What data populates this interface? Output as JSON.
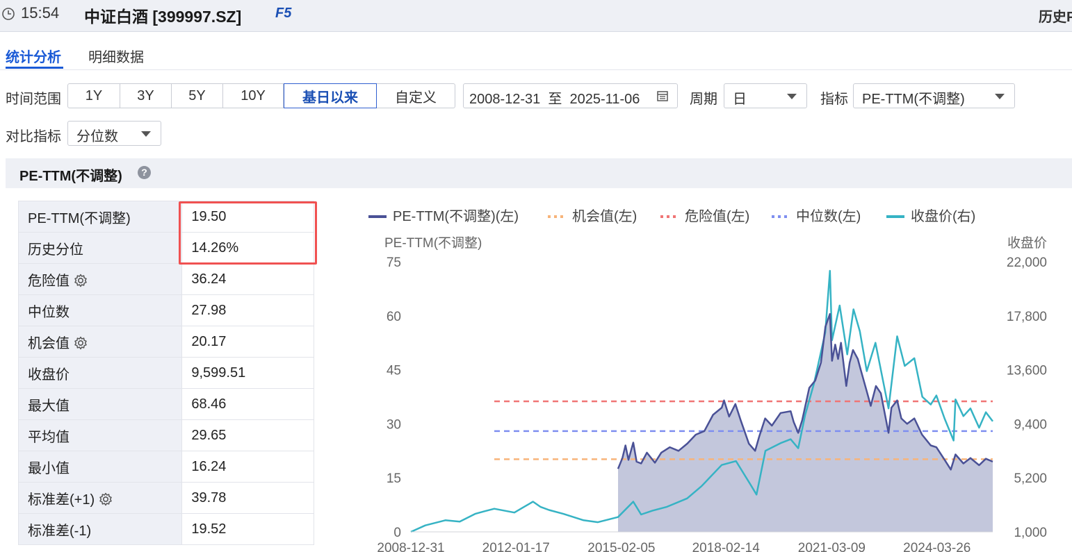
{
  "header": {
    "time": "15:54",
    "title": "中证白酒 [399997.SZ]",
    "f5": "F5",
    "history": "历史P"
  },
  "tabs": [
    {
      "label": "统计分析",
      "active": true
    },
    {
      "label": "明细数据",
      "active": false
    }
  ],
  "controls": {
    "time_range_label": "时间范围",
    "ranges": [
      "1Y",
      "3Y",
      "5Y",
      "10Y",
      "基日以来",
      "自定义"
    ],
    "active_range": "基日以来",
    "date_range": "2008-12-31  至  2025-11-06",
    "period_label": "周期",
    "period_value": "日",
    "indicator_label": "指标",
    "indicator_value": "PE-TTM(不调整)",
    "compare_label": "对比指标",
    "compare_value": "分位数"
  },
  "section": {
    "title": "PE-TTM(不调整)",
    "help_icon": "?"
  },
  "stats": [
    {
      "label": "PE-TTM(不调整)",
      "value": "19.50",
      "gear": false
    },
    {
      "label": "历史分位",
      "value": "14.26%",
      "gear": false
    },
    {
      "label": "危险值",
      "value": "36.24",
      "gear": true
    },
    {
      "label": "中位数",
      "value": "27.98",
      "gear": false
    },
    {
      "label": "机会值",
      "value": "20.17",
      "gear": true
    },
    {
      "label": "收盘价",
      "value": "9,599.51",
      "gear": false
    },
    {
      "label": "最大值",
      "value": "68.46",
      "gear": false
    },
    {
      "label": "平均值",
      "value": "29.65",
      "gear": false
    },
    {
      "label": "最小值",
      "value": "16.24",
      "gear": false
    },
    {
      "label": "标准差(+1)",
      "value": "39.78",
      "gear": true
    },
    {
      "label": "标准差(-1)",
      "value": "19.52",
      "gear": false
    }
  ],
  "chart_data": {
    "type": "line",
    "legend": [
      {
        "name": "PE-TTM(不调整)(左)",
        "style": "solid",
        "color": "#4a5196"
      },
      {
        "name": "机会值(左)",
        "style": "dotted",
        "color": "#f7b47a"
      },
      {
        "name": "危险值(左)",
        "style": "dotted",
        "color": "#f07575"
      },
      {
        "name": "中位数(左)",
        "style": "dotted",
        "color": "#7f8ff0"
      },
      {
        "name": "收盘价(右)",
        "style": "solid",
        "color": "#36b3c4"
      }
    ],
    "y_left_label": "PE-TTM(不调整)",
    "y_right_label": "收盘价",
    "y_left_ticks": [
      "75",
      "60",
      "45",
      "30",
      "15",
      "0"
    ],
    "y_right_ticks": [
      "22,000",
      "17,800",
      "13,600",
      "9,400",
      "5,200",
      "1,000"
    ],
    "y_left_range": [
      0,
      75
    ],
    "y_right_range": [
      1000,
      22000
    ],
    "x_ticks": [
      "2008-12-31",
      "2012-01-17",
      "2015-02-05",
      "2018-02-14",
      "2021-03-09",
      "2024-03-26"
    ],
    "x_range": [
      "2008-12-31",
      "2025-11-06"
    ],
    "reference_lines": {
      "danger": 36.24,
      "median": 27.98,
      "opportunity": 20.17
    },
    "pe_series": [
      [
        "2014-12-31",
        17.5
      ],
      [
        "2015-02-15",
        20.5
      ],
      [
        "2015-03-20",
        24.0
      ],
      [
        "2015-04-20",
        20.0
      ],
      [
        "2015-06-10",
        24.8
      ],
      [
        "2015-07-15",
        19.5
      ],
      [
        "2015-09-01",
        19.0
      ],
      [
        "2015-11-01",
        22.0
      ],
      [
        "2016-01-25",
        19.2
      ],
      [
        "2016-04-01",
        22.0
      ],
      [
        "2016-07-01",
        23.5
      ],
      [
        "2016-10-01",
        22.5
      ],
      [
        "2017-01-01",
        24.5
      ],
      [
        "2017-04-01",
        27.0
      ],
      [
        "2017-07-01",
        28.0
      ],
      [
        "2017-10-01",
        32.5
      ],
      [
        "2018-01-01",
        34.5
      ],
      [
        "2018-01-25",
        36.5
      ],
      [
        "2018-03-20",
        32.0
      ],
      [
        "2018-05-25",
        35.5
      ],
      [
        "2018-07-20",
        31.0
      ],
      [
        "2018-10-15",
        24.5
      ],
      [
        "2018-12-20",
        22.5
      ],
      [
        "2019-02-01",
        26.5
      ],
      [
        "2019-04-05",
        31.5
      ],
      [
        "2019-06-15",
        29.5
      ],
      [
        "2019-09-15",
        33.0
      ],
      [
        "2019-12-31",
        33.5
      ],
      [
        "2020-02-01",
        30.5
      ],
      [
        "2020-03-20",
        27.5
      ],
      [
        "2020-05-01",
        31.0
      ],
      [
        "2020-07-15",
        40.0
      ],
      [
        "2020-09-15",
        42.0
      ],
      [
        "2020-11-15",
        47.0
      ],
      [
        "2021-01-01",
        57.0
      ],
      [
        "2021-02-18",
        60.5
      ],
      [
        "2021-03-12",
        47.5
      ],
      [
        "2021-04-15",
        52.0
      ],
      [
        "2021-05-15",
        48.0
      ],
      [
        "2021-06-15",
        52.5
      ],
      [
        "2021-08-10",
        40.5
      ],
      [
        "2021-09-15",
        47.0
      ],
      [
        "2021-10-20",
        50.5
      ],
      [
        "2021-12-10",
        48.0
      ],
      [
        "2022-01-10",
        45.0
      ],
      [
        "2022-03-15",
        39.0
      ],
      [
        "2022-04-26",
        35.0
      ],
      [
        "2022-06-20",
        40.5
      ],
      [
        "2022-08-10",
        38.5
      ],
      [
        "2022-10-31",
        27.5
      ],
      [
        "2022-12-01",
        34.5
      ],
      [
        "2023-01-30",
        36.5
      ],
      [
        "2023-03-15",
        31.5
      ],
      [
        "2023-05-15",
        30.0
      ],
      [
        "2023-07-31",
        31.5
      ],
      [
        "2023-10-20",
        27.0
      ],
      [
        "2024-01-20",
        24.0
      ],
      [
        "2024-03-20",
        23.5
      ],
      [
        "2024-06-15",
        20.0
      ],
      [
        "2024-08-20",
        17.3
      ],
      [
        "2024-10-08",
        21.5
      ],
      [
        "2024-12-31",
        19.0
      ],
      [
        "2025-03-15",
        20.5
      ],
      [
        "2025-06-15",
        18.5
      ],
      [
        "2025-08-25",
        20.3
      ],
      [
        "2025-11-06",
        19.5
      ]
    ],
    "close_series": [
      [
        "2008-12-31",
        1000
      ],
      [
        "2009-06-01",
        1500
      ],
      [
        "2009-12-31",
        1900
      ],
      [
        "2010-06-01",
        1800
      ],
      [
        "2010-11-10",
        2400
      ],
      [
        "2011-02-15",
        2600
      ],
      [
        "2011-06-01",
        2800
      ],
      [
        "2011-12-31",
        2500
      ],
      [
        "2012-04-01",
        2900
      ],
      [
        "2012-07-15",
        3350
      ],
      [
        "2012-10-01",
        2950
      ],
      [
        "2012-12-31",
        2700
      ],
      [
        "2013-06-01",
        2400
      ],
      [
        "2013-12-31",
        1900
      ],
      [
        "2014-06-01",
        1750
      ],
      [
        "2014-12-31",
        2150
      ],
      [
        "2015-06-10",
        3350
      ],
      [
        "2015-09-01",
        2350
      ],
      [
        "2015-12-31",
        2650
      ],
      [
        "2016-06-01",
        2950
      ],
      [
        "2016-12-31",
        3600
      ],
      [
        "2017-06-01",
        4550
      ],
      [
        "2017-12-31",
        6200
      ],
      [
        "2018-06-01",
        6500
      ],
      [
        "2018-10-30",
        4700
      ],
      [
        "2019-01-04",
        3900
      ],
      [
        "2019-04-08",
        7300
      ],
      [
        "2019-09-15",
        7900
      ],
      [
        "2019-12-31",
        8200
      ],
      [
        "2020-03-20",
        7500
      ],
      [
        "2020-06-01",
        10100
      ],
      [
        "2020-09-01",
        12500
      ],
      [
        "2020-12-31",
        16500
      ],
      [
        "2021-02-18",
        21300
      ],
      [
        "2021-03-12",
        15900
      ],
      [
        "2021-06-01",
        18600
      ],
      [
        "2021-08-20",
        14800
      ],
      [
        "2021-10-25",
        18300
      ],
      [
        "2021-12-31",
        16600
      ],
      [
        "2022-03-15",
        13500
      ],
      [
        "2022-06-15",
        15700
      ],
      [
        "2022-10-31",
        10600
      ],
      [
        "2023-01-30",
        16200
      ],
      [
        "2023-04-20",
        13900
      ],
      [
        "2023-07-31",
        14500
      ],
      [
        "2023-10-23",
        11500
      ],
      [
        "2024-01-20",
        10900
      ],
      [
        "2024-03-20",
        11600
      ],
      [
        "2024-06-15",
        9800
      ],
      [
        "2024-09-18",
        8100
      ],
      [
        "2024-10-08",
        11300
      ],
      [
        "2024-12-31",
        10000
      ],
      [
        "2025-03-15",
        10600
      ],
      [
        "2025-06-15",
        9100
      ],
      [
        "2025-08-25",
        10300
      ],
      [
        "2025-11-06",
        9599.51
      ]
    ]
  }
}
